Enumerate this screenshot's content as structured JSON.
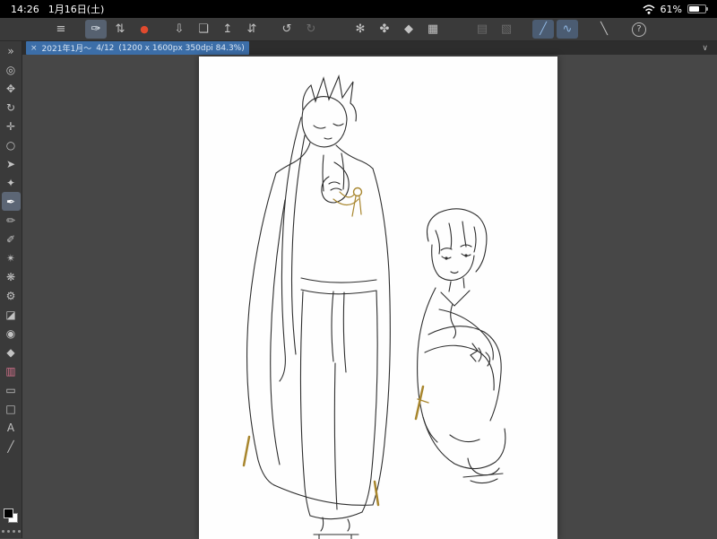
{
  "theme": {
    "toolbar_bg": "#3a3a3a",
    "canvas_bg": "#474747",
    "selection_blue": "#3c6ea8",
    "accent_blue": "#8fb6e0",
    "record_red": "#e04a2e",
    "gold": "#a8862e"
  },
  "status_bar": {
    "time": "14:26",
    "date": "1月16日(土)",
    "battery_percent": "61%"
  },
  "toolbar": {
    "icons": [
      {
        "name": "menu-icon",
        "glyph": "≡"
      },
      {
        "name": "brush-select-icon",
        "glyph": "✑"
      },
      {
        "name": "tool-switch-icon",
        "glyph": "⇅"
      },
      {
        "name": "record-icon",
        "glyph": "●"
      },
      {
        "name": "import-icon",
        "glyph": "⇩"
      },
      {
        "name": "folder-icon",
        "glyph": "❏"
      },
      {
        "name": "export-icon",
        "glyph": "↥"
      },
      {
        "name": "panel-switch-icon",
        "glyph": "⇵"
      },
      {
        "name": "undo-icon",
        "glyph": "↺"
      },
      {
        "name": "redo-icon",
        "glyph": "↻"
      },
      {
        "name": "spray-icon",
        "glyph": "✻"
      },
      {
        "name": "blend-mode-icon",
        "glyph": "✤"
      },
      {
        "name": "fill-icon",
        "glyph": "◆"
      },
      {
        "name": "crop-icon",
        "glyph": "▦"
      },
      {
        "name": "material-icon",
        "glyph": "▤"
      },
      {
        "name": "layer-icon",
        "glyph": "▧"
      },
      {
        "name": "ruler-line-icon",
        "glyph": "╱"
      },
      {
        "name": "ruler-curve-icon",
        "glyph": "∿"
      },
      {
        "name": "perspective-icon",
        "glyph": "╲"
      },
      {
        "name": "help-icon",
        "glyph": "?"
      }
    ]
  },
  "tab_bar": {
    "close_glyph": "×",
    "title": "2021年1月～",
    "page": "4/12",
    "info": "(1200 x 1600px 350dpi 84.3%)",
    "collapse_glyph": "∨"
  },
  "sidebar": {
    "tools": [
      {
        "name": "collapse-icon",
        "glyph": "»"
      },
      {
        "name": "zoom-tool-icon",
        "glyph": "◎"
      },
      {
        "name": "hand-tool-icon",
        "glyph": "✥"
      },
      {
        "name": "rotate-tool-icon",
        "glyph": "↻"
      },
      {
        "name": "move-tool-icon",
        "glyph": "✛"
      },
      {
        "name": "lasso-tool-icon",
        "glyph": "○"
      },
      {
        "name": "operation-tool-icon",
        "glyph": "➤"
      },
      {
        "name": "autoselect-tool-icon",
        "glyph": "✦"
      },
      {
        "name": "pen-tool-icon",
        "glyph": "✒"
      },
      {
        "name": "pencil-tool-icon",
        "glyph": "✏"
      },
      {
        "name": "brush-tool-icon",
        "glyph": "✐"
      },
      {
        "name": "airbrush-tool-icon",
        "glyph": "✴"
      },
      {
        "name": "decoration-tool-icon",
        "glyph": "❋"
      },
      {
        "name": "figure-tool-icon",
        "glyph": "⚙"
      },
      {
        "name": "eraser-tool-icon",
        "glyph": "◪"
      },
      {
        "name": "blend-tool-icon",
        "glyph": "◉"
      },
      {
        "name": "fill-tool-icon",
        "glyph": "◆"
      },
      {
        "name": "colormix-tool-icon",
        "glyph": "▥"
      },
      {
        "name": "frame-tool-icon",
        "glyph": "▭"
      },
      {
        "name": "balloon-tool-icon",
        "glyph": "□"
      },
      {
        "name": "text-tool-icon",
        "glyph": "A"
      },
      {
        "name": "line-tool-icon",
        "glyph": "╱"
      }
    ],
    "foreground_color": "#000000",
    "background_color": "#ffffff"
  }
}
